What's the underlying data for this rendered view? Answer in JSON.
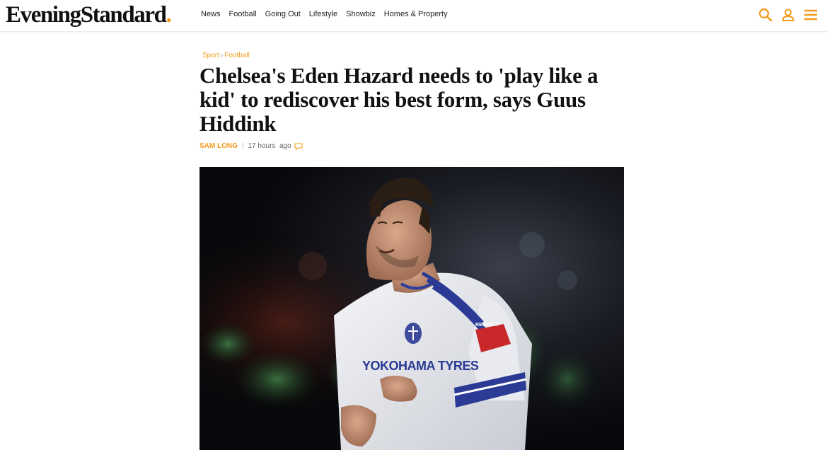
{
  "site": {
    "logo_text": "EveningStandard",
    "logo_dot": ".",
    "brand_color": "#f39a1d"
  },
  "nav": {
    "items": [
      "News",
      "Football",
      "Going Out",
      "Lifestyle",
      "Showbiz",
      "Homes & Property"
    ]
  },
  "header_icons": [
    "search-icon",
    "user-icon",
    "menu-icon"
  ],
  "article": {
    "breadcrumb": [
      "Sport",
      "Football"
    ],
    "breadcrumb_separator": "›",
    "headline": "Chelsea's Eden Hazard needs to 'play like a kid' to rediscover his best form, says Guus Hiddink",
    "author": "SAM LONG",
    "byline_separator": "|",
    "timestamp": "17 hours  ago",
    "comment_icon": "comment-icon"
  },
  "hero_image": {
    "jersey_sponsor": "YOKOHAMA TYRES",
    "sleeve_badge": "RESPECT"
  }
}
